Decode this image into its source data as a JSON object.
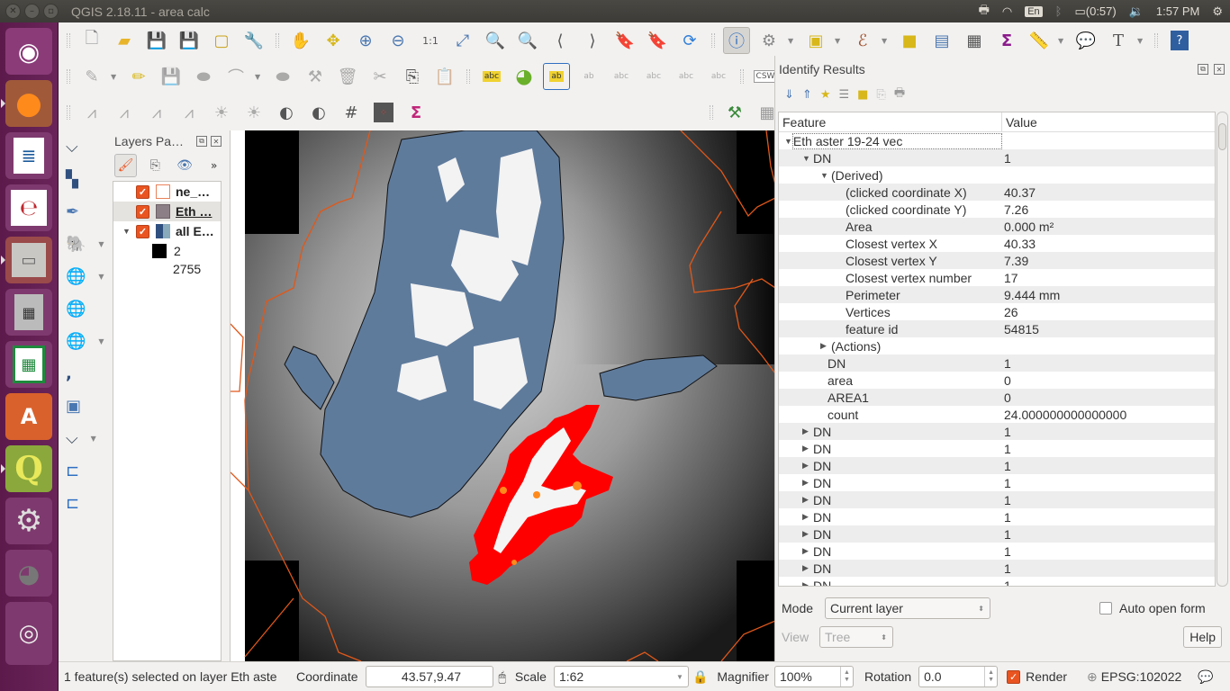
{
  "window": {
    "title": "QGIS 2.18.11 - area calc",
    "buttons": [
      "close",
      "minimize",
      "maximize"
    ]
  },
  "system_tray": {
    "keyboard_layout": "En",
    "battery": "(0:57)",
    "clock": "1:57 PM",
    "icons": [
      "printer-icon",
      "wifi-icon",
      "bluetooth-icon",
      "battery-icon",
      "volume-icon",
      "power-icon"
    ]
  },
  "launcher": {
    "apps": [
      "Ubuntu Dash",
      "Firefox",
      "LibreOffice Writer",
      "Document Viewer",
      "Files",
      "Calculator",
      "LibreOffice Calc",
      "Ubuntu Software",
      "QGIS",
      "System Settings",
      "GIMP",
      "Rhythmbox",
      "Google Earth",
      "Trash"
    ]
  },
  "toolbars": {
    "row1": [
      "New Project",
      "Open Project",
      "Save Project",
      "Save As",
      "New Print Composer",
      "Composer Manager",
      "Pan Map",
      "Pan to Selection",
      "Zoom In",
      "Zoom Out",
      "Zoom 1:1",
      "Zoom Full",
      "Zoom to Selection",
      "Zoom to Layer",
      "Zoom Last",
      "Zoom Next",
      "New Bookmark",
      "Show Bookmarks",
      "Refresh",
      "Identify Features",
      "Run Feature Action",
      "Select Features",
      "Select by Expression",
      "Deselect All",
      "Open Attribute Table",
      "Open Field Calculator",
      "Show Statistical Summary",
      "Measure Line",
      "Map Tips",
      "Text Annotation",
      "Help"
    ],
    "row2": [
      "Current Edits",
      "Toggle Editing",
      "Save Layer Edits",
      "Add Feature",
      "Node Tool",
      "Move Feature",
      "Vertex Tool",
      "Delete Selected",
      "Cut Features",
      "Copy Features",
      "Paste Features",
      "Layer Labeling",
      "Layer Diagram",
      "Pin/Unpin Labels",
      "Highlight Pinned Labels",
      "Show/Hide Labels",
      "Move Label",
      "Rotate Label",
      "Change Label",
      "CSW"
    ],
    "row3": [
      "Local Histogram Stretch",
      "Full Histogram Stretch",
      "Local Cumulative Stretch",
      "Full Cumulative Stretch",
      "Increase Brightness",
      "Decrease Brightness",
      "Increase Contrast",
      "Decrease Contrast",
      "Coordinate Capture",
      "Raster Calculator",
      "Zonal Statistics",
      "GRASS Tools",
      "Georeferencer"
    ],
    "csw_label": "CSW"
  },
  "left_tools": [
    "Add Vector Layer",
    "Add Raster Layer",
    "Add SpatiaLite Layer",
    "Add PostGIS Layer",
    "Add WMS Layer",
    "Add WFS Layer",
    "Add WCS Layer",
    "Add Delimited Text Layer",
    "Add Virtual Layer",
    "New Shapefile Layer",
    "Add Oracle Layer",
    "Add GeoNode Layer"
  ],
  "layers_panel": {
    "title": "Layers Pa…",
    "layers": [
      {
        "name": "ne_…",
        "checked": true,
        "swatch": "#ffffff",
        "swatch_border": "#e9825a",
        "selected": false
      },
      {
        "name": "Eth …",
        "checked": true,
        "swatch": "#8c7f86",
        "swatch_border": "#6d6066",
        "selected": true
      },
      {
        "name": "all E…",
        "checked": true,
        "swatch": "raster",
        "selected": false,
        "expanded": true
      }
    ],
    "legend": {
      "value_label": "2",
      "max_label": "2755"
    }
  },
  "identify": {
    "title": "Identify Results",
    "columns": [
      "Feature",
      "Value"
    ],
    "rows": [
      {
        "level": 0,
        "toggle": "down",
        "feature": "Eth aster 19-24 vec",
        "value": ""
      },
      {
        "level": 1,
        "toggle": "down",
        "feature": "DN",
        "value": "1"
      },
      {
        "level": 2,
        "toggle": "down",
        "feature": "(Derived)",
        "value": ""
      },
      {
        "level": 3,
        "toggle": "",
        "feature": "(clicked coordinate X)",
        "value": "40.37"
      },
      {
        "level": 3,
        "toggle": "",
        "feature": "(clicked coordinate Y)",
        "value": "7.26"
      },
      {
        "level": 3,
        "toggle": "",
        "feature": "Area",
        "value": "0.000 m²"
      },
      {
        "level": 3,
        "toggle": "",
        "feature": "Closest vertex X",
        "value": "40.33"
      },
      {
        "level": 3,
        "toggle": "",
        "feature": "Closest vertex Y",
        "value": "7.39"
      },
      {
        "level": 3,
        "toggle": "",
        "feature": "Closest vertex number",
        "value": "17"
      },
      {
        "level": 3,
        "toggle": "",
        "feature": "Perimeter",
        "value": "9.444 mm"
      },
      {
        "level": 3,
        "toggle": "",
        "feature": "Vertices",
        "value": "26"
      },
      {
        "level": 3,
        "toggle": "",
        "feature": "feature id",
        "value": "54815"
      },
      {
        "level": 2,
        "toggle": "right",
        "feature": "(Actions)",
        "value": ""
      },
      {
        "level": 2,
        "toggle": "",
        "feature": "DN",
        "value": "1"
      },
      {
        "level": 2,
        "toggle": "",
        "feature": "area",
        "value": "0"
      },
      {
        "level": 2,
        "toggle": "",
        "feature": "AREA1",
        "value": "0"
      },
      {
        "level": 2,
        "toggle": "",
        "feature": "count",
        "value": "24.000000000000000"
      },
      {
        "level": 1,
        "toggle": "right",
        "feature": "DN",
        "value": "1"
      },
      {
        "level": 1,
        "toggle": "right",
        "feature": "DN",
        "value": "1"
      },
      {
        "level": 1,
        "toggle": "right",
        "feature": "DN",
        "value": "1"
      },
      {
        "level": 1,
        "toggle": "right",
        "feature": "DN",
        "value": "1"
      },
      {
        "level": 1,
        "toggle": "right",
        "feature": "DN",
        "value": "1"
      },
      {
        "level": 1,
        "toggle": "right",
        "feature": "DN",
        "value": "1"
      },
      {
        "level": 1,
        "toggle": "right",
        "feature": "DN",
        "value": "1"
      },
      {
        "level": 1,
        "toggle": "right",
        "feature": "DN",
        "value": "1"
      },
      {
        "level": 1,
        "toggle": "right",
        "feature": "DN",
        "value": "1"
      },
      {
        "level": 1,
        "toggle": "right",
        "feature": "DN",
        "value": "1"
      }
    ],
    "mode_label": "Mode",
    "mode_value": "Current layer",
    "auto_open_label": "Auto open form",
    "auto_open_checked": false,
    "view_label": "View",
    "view_value": "Tree",
    "help_label": "Help"
  },
  "statusbar": {
    "message": "1 feature(s) selected on layer Eth aste",
    "coordinate_label": "Coordinate",
    "coordinate_value": "43.57,9.47",
    "scale_label": "Scale",
    "scale_value": "1:62",
    "magnifier_label": "Magnifier",
    "magnifier_value": "100%",
    "rotation_label": "Rotation",
    "rotation_value": "0.0",
    "render_label": "Render",
    "render_checked": true,
    "crs": "EPSG:102022"
  },
  "colors": {
    "accent": "#e95420",
    "selection": "#ff0000",
    "polygon_fill": "#5f7b9c",
    "boundary": "#e0581a",
    "launcher_bg": "#5c1a4b"
  }
}
